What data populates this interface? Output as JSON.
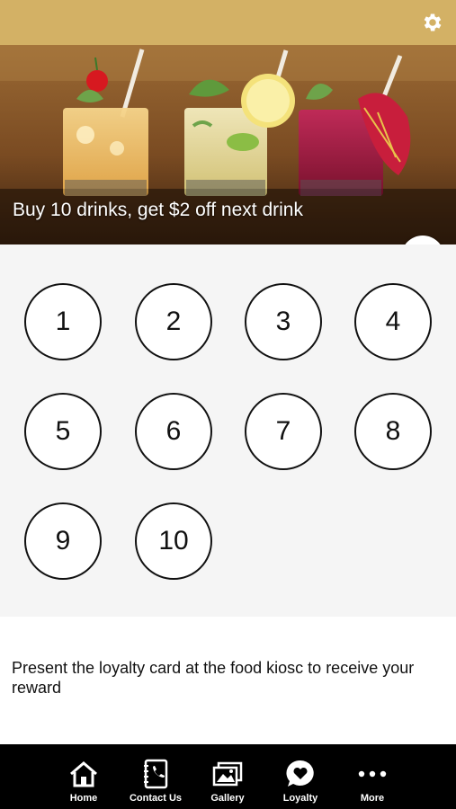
{
  "colors": {
    "topbar": "#d3b165",
    "stamp_area": "#f5f5f5",
    "nav_background": "#000000"
  },
  "header": {
    "settings_icon": "gear-icon"
  },
  "banner": {
    "title": "Buy 10 drinks, get $2 off next drink",
    "share_icon": "share-icon"
  },
  "stamps": [
    "1",
    "2",
    "3",
    "4",
    "5",
    "6",
    "7",
    "8",
    "9",
    "10"
  ],
  "message": "Present the loyalty card at the food kiosc to receive your reward",
  "nav": [
    {
      "label": "Home",
      "icon": "home-icon"
    },
    {
      "label": "Contact Us",
      "icon": "contact-book-icon"
    },
    {
      "label": "Gallery",
      "icon": "gallery-icon"
    },
    {
      "label": "Loyalty",
      "icon": "heart-bubble-icon"
    },
    {
      "label": "More",
      "icon": "more-dots-icon"
    }
  ]
}
